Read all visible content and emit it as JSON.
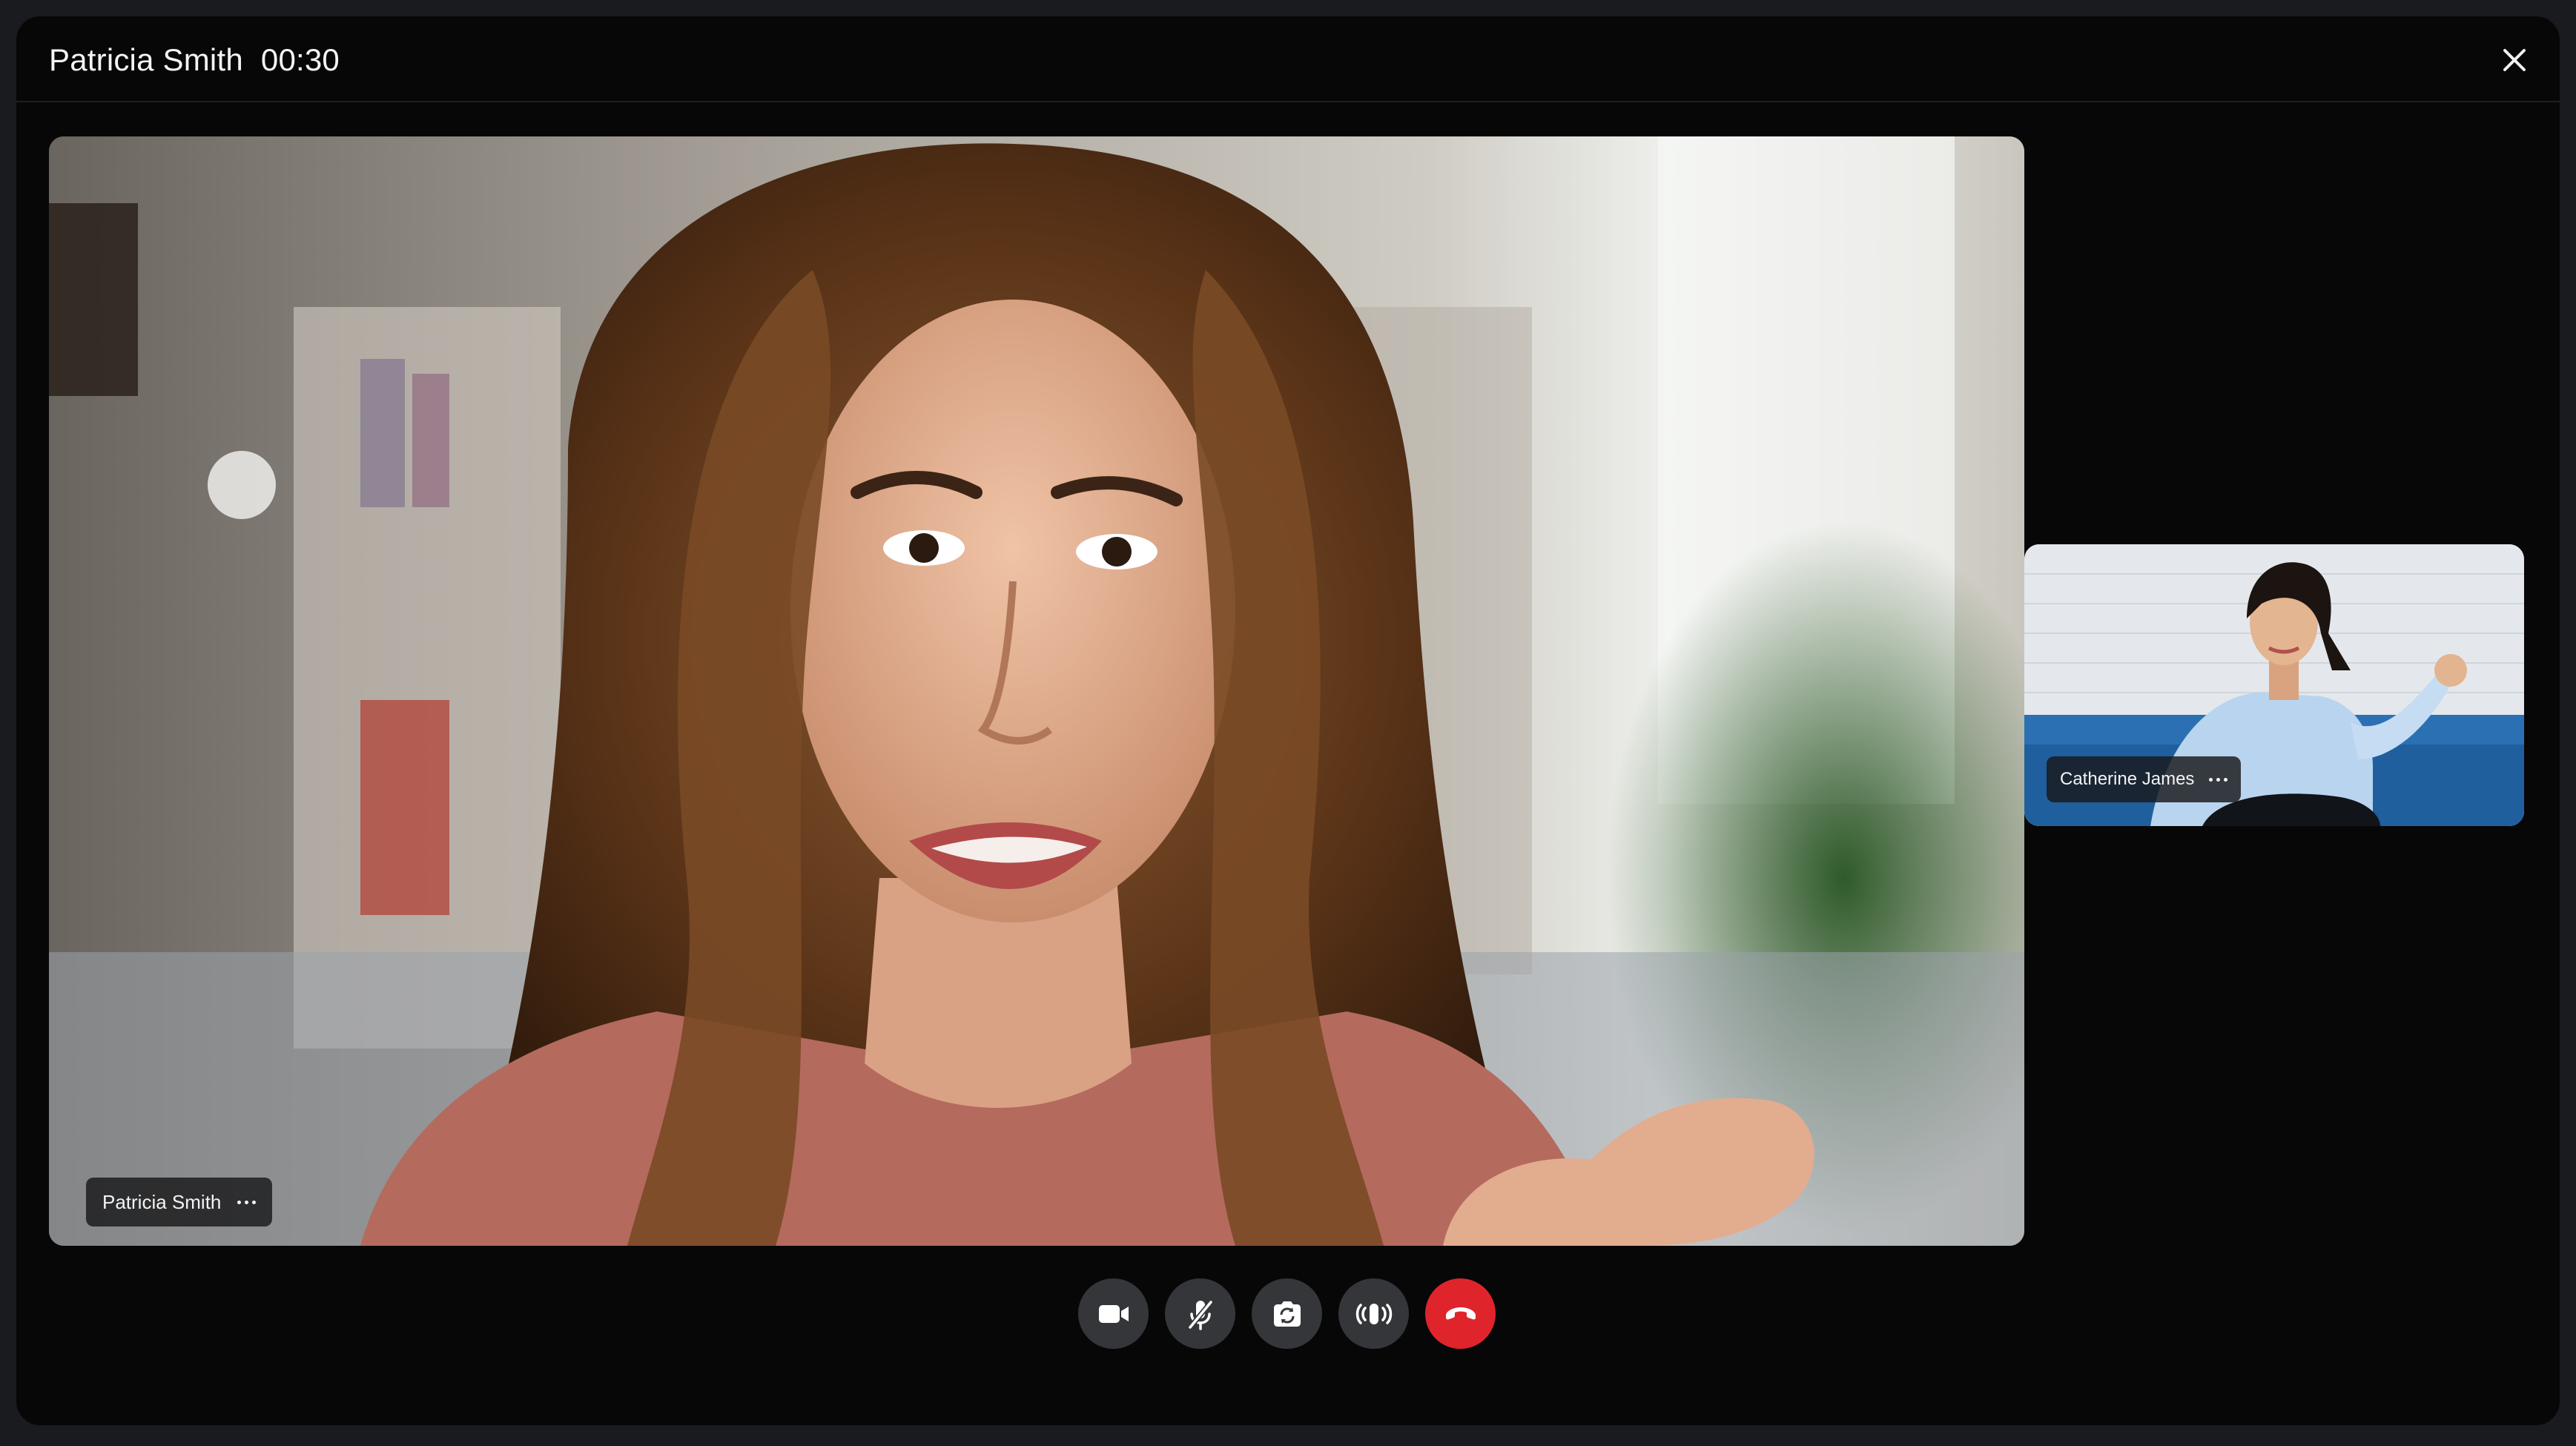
{
  "call": {
    "caller_name": "Patricia Smith",
    "duration": "00:30"
  },
  "main_participant": {
    "name": "Patricia Smith"
  },
  "side_participant": {
    "name": "Catherine James"
  },
  "controls": {
    "camera": "video-camera-icon",
    "mute": "microphone-off-icon",
    "switch_camera": "switch-camera-icon",
    "speaker": "speaker-icon",
    "end_call": "hang-up-icon"
  },
  "colors": {
    "background": "#070708",
    "control_button": "#35363a",
    "end_call": "#e0242c",
    "text": "#f4f4f6"
  }
}
